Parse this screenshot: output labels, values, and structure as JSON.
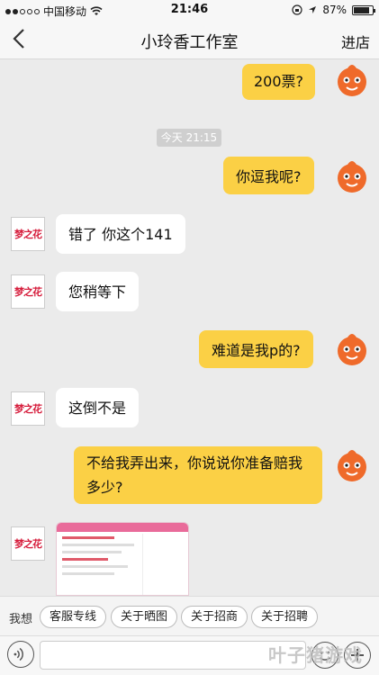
{
  "status_bar": {
    "carrier": "中国移动",
    "time": "21:46",
    "battery_text": "87%",
    "battery_level": 0.87
  },
  "nav": {
    "title": "小玲香工作室",
    "right_label": "进店"
  },
  "chat": {
    "timestamp": "今天 21:15",
    "messages": [
      {
        "from": "me",
        "text": "200票?"
      },
      {
        "from": "me",
        "text": "你逗我呢?"
      },
      {
        "from": "them",
        "text": "错了 你这个141"
      },
      {
        "from": "them",
        "text": "您稍等下"
      },
      {
        "from": "me",
        "text": "难道是我p的?"
      },
      {
        "from": "them",
        "text": "这倒不是"
      },
      {
        "from": "me",
        "text_line1": "不给我弄出来，你说说你准备赔我",
        "text_line2": "多少?"
      },
      {
        "from": "them",
        "type": "image"
      }
    ],
    "shop_logo_text": "梦之花"
  },
  "quick_replies": {
    "label": "我想",
    "chips": [
      "客服专线",
      "关于晒图",
      "关于招商",
      "关于招聘"
    ]
  },
  "input": {
    "placeholder": ""
  },
  "watermark": "叶子猪游戏",
  "colors": {
    "my_bubble": "#fbd045",
    "their_bubble": "#ffffff",
    "background": "#ebebeb"
  }
}
